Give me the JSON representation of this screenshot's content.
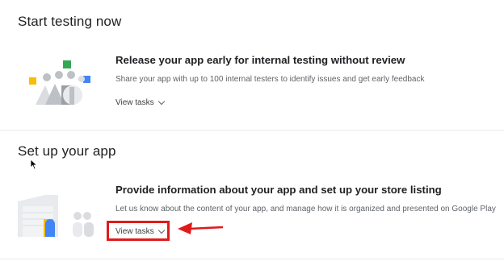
{
  "sections": [
    {
      "title": "Start testing now",
      "task": {
        "heading": "Release your app early for internal testing without review",
        "description": "Share your app with up to 100 internal testers to identify issues and get early feedback",
        "action_label": "View tasks",
        "action_icon": "chevron-down-icon"
      }
    },
    {
      "title": "Set up your app",
      "task": {
        "heading": "Provide information about your app and set up your store listing",
        "description": "Let us know about the content of your app, and manage how it is organized and presented on Google Play",
        "action_label": "View tasks",
        "action_icon": "chevron-down-icon"
      }
    }
  ],
  "colors": {
    "annotation_red": "#e01a1a",
    "google_green": "#34a853",
    "google_blue": "#4285f4",
    "google_yellow": "#fbbc04"
  }
}
